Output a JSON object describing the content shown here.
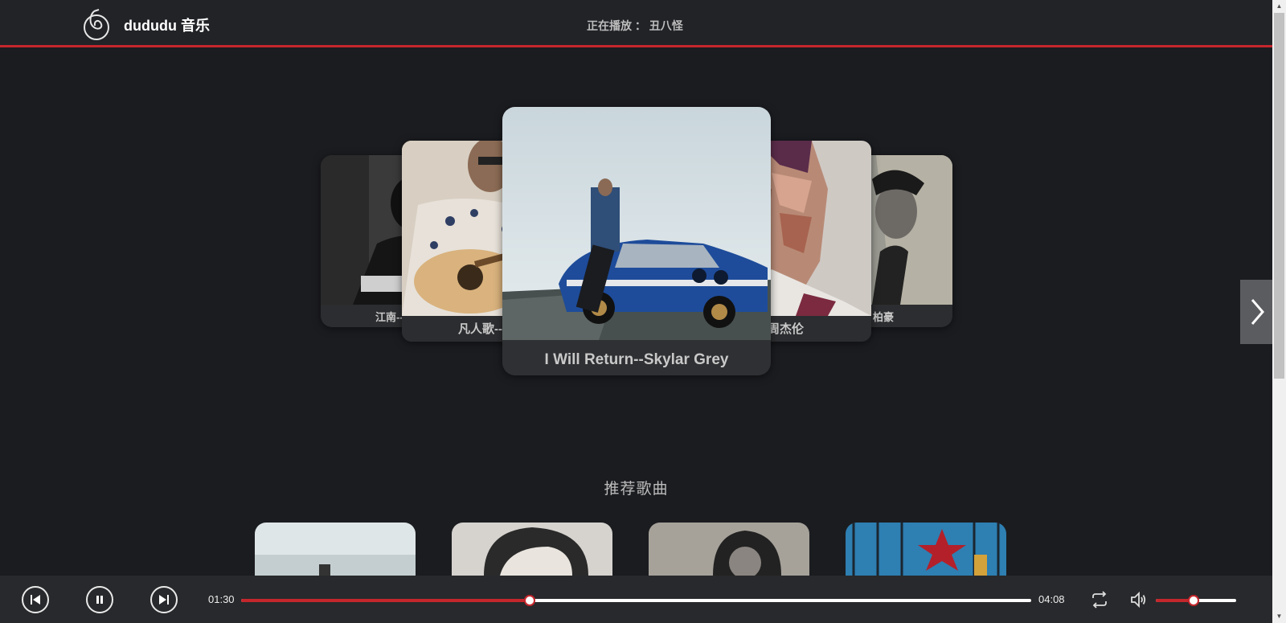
{
  "header": {
    "brand": "dududu 音乐",
    "now_playing_label": "正在播放 ：",
    "now_playing_title": "丑八怪"
  },
  "carousel": {
    "items": [
      {
        "caption": "江南--"
      },
      {
        "caption": "凡人歌--"
      },
      {
        "caption": "I Will Return--Skylar Grey"
      },
      {
        "caption": "周杰伦"
      },
      {
        "caption": "柏豪"
      }
    ]
  },
  "recommend": {
    "title": "推荐歌曲"
  },
  "player": {
    "current_time": "01:30",
    "total_time": "04:08",
    "progress": 0.365,
    "volume": 0.47,
    "accent": "#c4262c"
  }
}
